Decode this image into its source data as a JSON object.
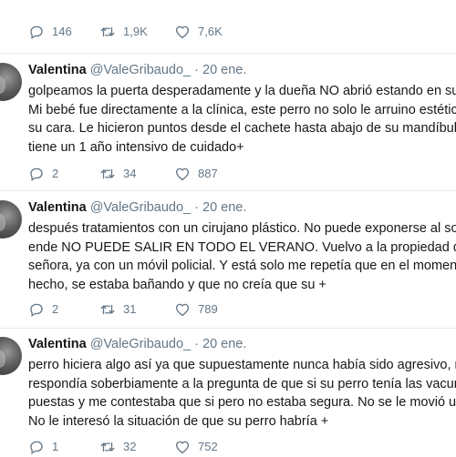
{
  "top_actions": {
    "replies": "146",
    "retweets": "1,9K",
    "likes": "7,6K"
  },
  "tweets": [
    {
      "name": "Valentina",
      "handle": "@ValeGribaudo_",
      "separator": "·",
      "date": "20 ene.",
      "lines": [
        "golpeamos la puerta desperadamente y la dueña NO abrió estando en su ca",
        "Mi bebé fue directamente a la clínica, este perro no solo le arruino estéticam",
        "su cara. Le hicieron puntos desde el cachete hasta abajo de su mandíbula. M",
        "tiene un 1 año intensivo de cuidado+"
      ],
      "replies": "2",
      "retweets": "34",
      "likes": "887"
    },
    {
      "name": "Valentina",
      "handle": "@ValeGribaudo_",
      "separator": "·",
      "date": "20 ene.",
      "lines": [
        "después tratamientos con un cirujano plástico. No puede exponerse al sol, p",
        "ende NO PUEDE SALIR EN TODO EL VERANO. Vuelvo a la propiedad de esta",
        "señora, ya con un móvil policial. Y está solo me repetía que en el momento d",
        "hecho, se estaba bañando y que no creía que su +"
      ],
      "replies": "2",
      "retweets": "31",
      "likes": "789"
    },
    {
      "name": "Valentina",
      "handle": "@ValeGribaudo_",
      "separator": "·",
      "date": "20 ene.",
      "lines": [
        "perro hiciera algo así ya que supuestamente nunca había sido agresivo, me",
        "respondía soberbiamente a la pregunta de que si su perro tenía las vacunas",
        "puestas y me contestaba que si pero no estaba segura. No se le movió un pe",
        "No le interesó la situación de que su perro habría +"
      ],
      "replies": "1",
      "retweets": "32",
      "likes": "752"
    }
  ],
  "icons": {
    "reply": "reply-icon",
    "retweet": "retweet-icon",
    "like": "heart-icon"
  },
  "colors": {
    "text": "#14171a",
    "secondary": "#657786",
    "separator": "#e6ecf0"
  }
}
